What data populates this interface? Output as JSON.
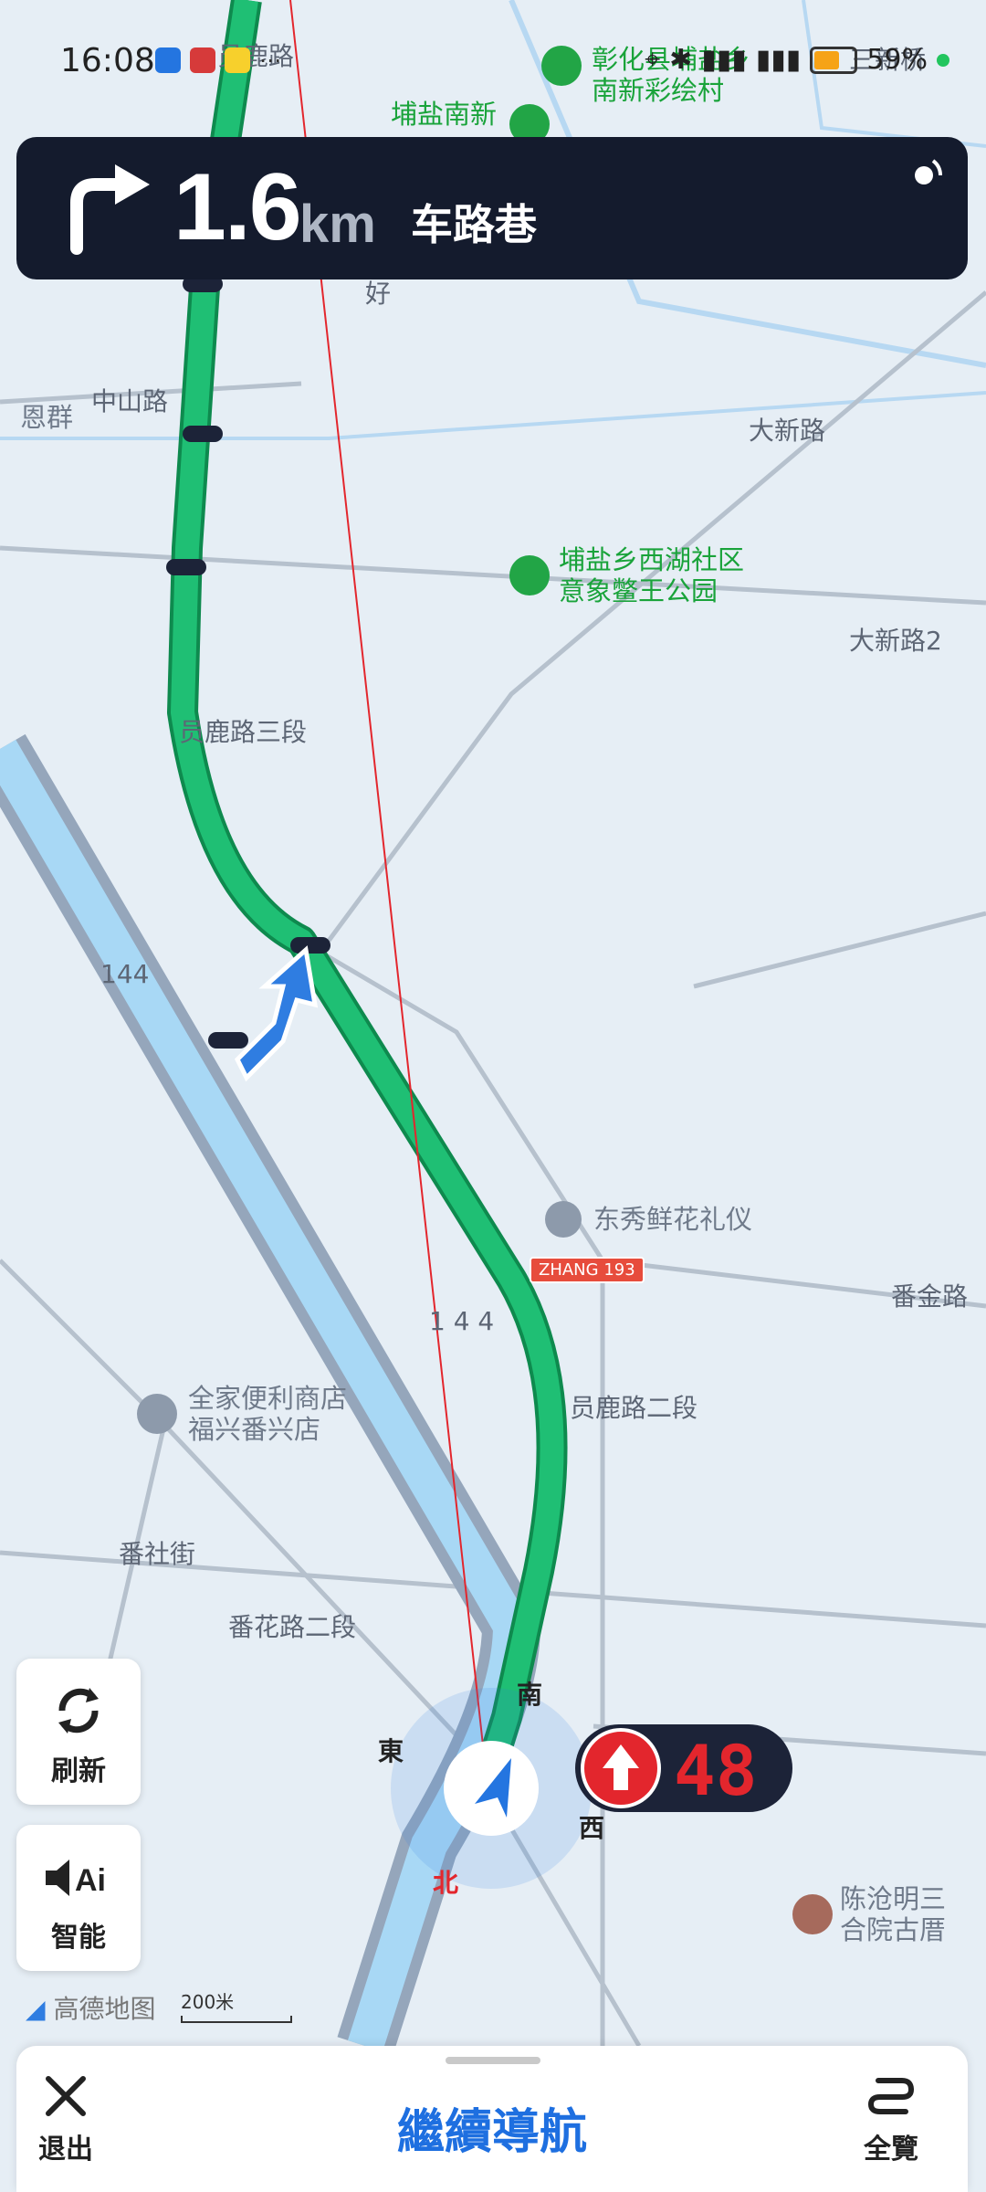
{
  "status_bar": {
    "time": "16:08",
    "battery": "59%",
    "battery_level": 0.59
  },
  "nav_banner": {
    "distance": "1.6",
    "unit": "km",
    "road": "车路巷"
  },
  "map": {
    "pois": [
      {
        "name": "埔盐南新",
        "icon": "park-icon"
      },
      {
        "name": "彰化县埔盐乡\n南新彩绘村",
        "icon": "pin-icon"
      },
      {
        "name": "埔盐乡西湖社区\n意象鳖王公园",
        "icon": "park-icon"
      },
      {
        "name": "东秀鲜花礼仪",
        "icon": "flower-icon"
      },
      {
        "name": "全家便利商店\n福兴番兴店",
        "icon": "store-icon"
      },
      {
        "name": "陈沧明三\n合院古厝",
        "icon": "temple-icon"
      },
      {
        "name": "恩群",
        "icon": "pin-icon"
      }
    ],
    "roads": [
      "中山路",
      "大新路",
      "大新路2",
      "员鹿路",
      "员鹿路三段",
      "员鹿路二段",
      "番金路",
      "番社街",
      "番花路二段",
      "144",
      "1 4 4",
      "好",
      "三新桥"
    ],
    "compass": {
      "north": "北",
      "south": "南",
      "east": "東",
      "west": "西"
    },
    "plate": "ZHANG 193",
    "logo": "高德地图",
    "scale": "200米"
  },
  "speed_limit": {
    "value": "48"
  },
  "side_buttons": {
    "refresh": "刷新",
    "smart": "智能"
  },
  "bottom_bar": {
    "exit": "退出",
    "continue": "繼續導航",
    "overview": "全覽"
  }
}
